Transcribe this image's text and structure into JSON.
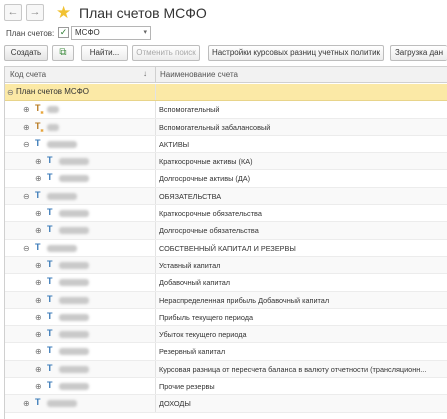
{
  "window": {
    "title": "План счетов МСФО",
    "back_glyph": "←",
    "forward_glyph": "→",
    "star_glyph": "★"
  },
  "filter": {
    "label": "План счетов:",
    "checked_glyph": "✓",
    "value": "МСФО",
    "arrow_glyph": "▾"
  },
  "toolbar": {
    "create_label": "Создать",
    "find_label": "Найти...",
    "cancel_search_label": "Отменить поиск",
    "currency_settings_label": "Настройки курсовых разниц учетных политик",
    "load_label": "Загрузка дан"
  },
  "grid": {
    "col_code": "Код счета",
    "col_name": "Наименование счета",
    "sort_glyph": "↓",
    "root_label": "План счетов МСФО",
    "expand_glyph": "⊖",
    "collapsed_glyph": "⊕",
    "rows": [
      {
        "name": "Вспомогательный",
        "icon": "Т",
        "sub": "н"
      },
      {
        "name": "Вспомогательный забалансовый",
        "icon": "Т",
        "sub": "н"
      },
      {
        "name": "АКТИВЫ",
        "icon": "Т",
        "sub": ""
      },
      {
        "name": "Краткосрочные активы (КА)",
        "icon": "Т",
        "sub": ""
      },
      {
        "name": "Долгосрочные активы (ДА)",
        "icon": "Т",
        "sub": ""
      },
      {
        "name": "ОБЯЗАТЕЛЬСТВА",
        "icon": "Т",
        "sub": ""
      },
      {
        "name": "Краткосрочные обязательства",
        "icon": "Т",
        "sub": ""
      },
      {
        "name": "Долгосрочные обязательства",
        "icon": "Т",
        "sub": ""
      },
      {
        "name": "СОБСТВЕННЫЙ КАПИТАЛ И РЕЗЕРВЫ",
        "icon": "Т",
        "sub": ""
      },
      {
        "name": "Уставный капитал",
        "icon": "Т",
        "sub": ""
      },
      {
        "name": "Добавочный капитал",
        "icon": "Т",
        "sub": ""
      },
      {
        "name": "Нераспределенная прибыль Добавочный капитал",
        "icon": "Т",
        "sub": ""
      },
      {
        "name": "Прибыль текущего периода",
        "icon": "Т",
        "sub": ""
      },
      {
        "name": "Убыток текущего периода",
        "icon": "Т",
        "sub": ""
      },
      {
        "name": "Резервный капитал",
        "icon": "Т",
        "sub": ""
      },
      {
        "name": "Курсовая разница от пересчета баланса в валюту отчетности (трансляционн...",
        "icon": "Т",
        "sub": ""
      },
      {
        "name": "Прочие резервы",
        "icon": "Т",
        "sub": ""
      },
      {
        "name": "ДОХОДЫ",
        "icon": "Т",
        "sub": ""
      }
    ]
  }
}
